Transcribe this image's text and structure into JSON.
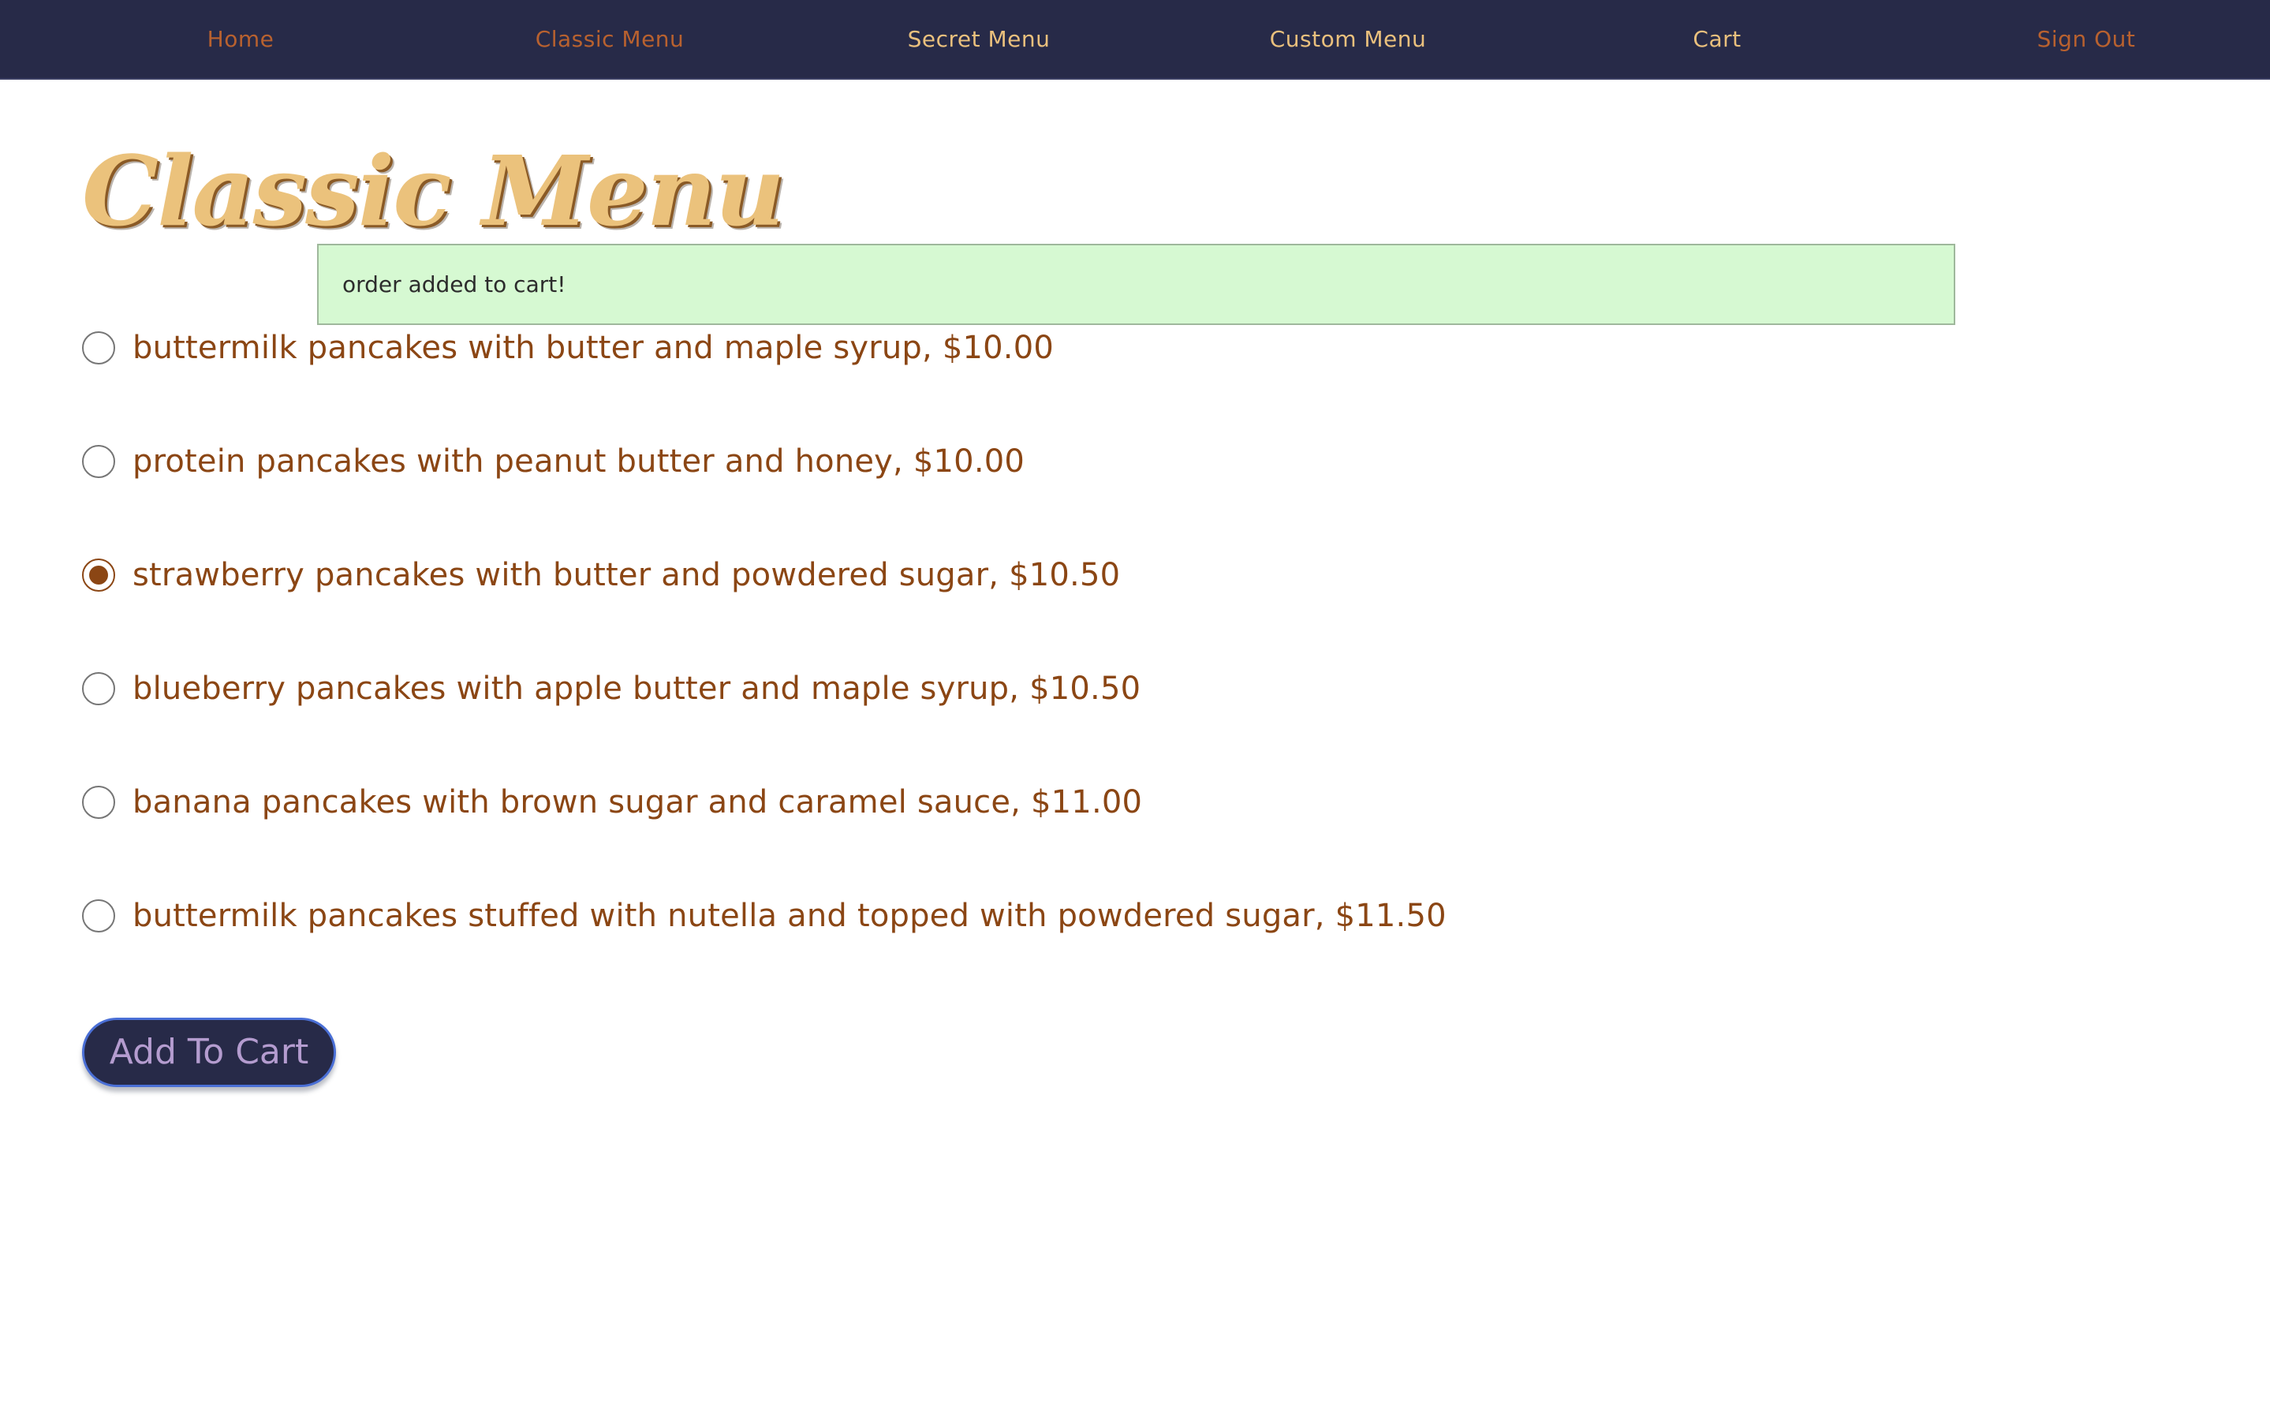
{
  "nav": {
    "items": [
      {
        "label": "Home"
      },
      {
        "label": "Classic Menu"
      },
      {
        "label": "Secret Menu"
      },
      {
        "label": "Custom Menu"
      },
      {
        "label": "Cart"
      },
      {
        "label": "Sign Out"
      }
    ]
  },
  "page": {
    "title": "Classic Menu"
  },
  "flash": {
    "message": "order added to cart!"
  },
  "menu": {
    "selected_index": 2,
    "options": [
      {
        "label": "buttermilk pancakes with butter and maple syrup, $10.00",
        "checked": false
      },
      {
        "label": "protein pancakes with peanut butter and honey, $10.00",
        "checked": false
      },
      {
        "label": "strawberry pancakes with butter and powdered sugar, $10.50",
        "checked": true
      },
      {
        "label": "blueberry pancakes with apple butter and maple syrup, $10.50",
        "checked": false
      },
      {
        "label": "banana pancakes with brown sugar and caramel sauce, $11.00",
        "checked": false
      },
      {
        "label": "buttermilk pancakes stuffed with nutella and topped with powdered sugar, $11.50",
        "checked": false
      }
    ]
  },
  "actions": {
    "add_to_cart_label": "Add To Cart"
  },
  "colors": {
    "navbar_bg": "#272a48",
    "nav_link": "#b8612f",
    "nav_link_alt": "#eac07d",
    "title": "#ebc27c",
    "option_text": "#8b4614",
    "flash_bg": "#d6f9d2",
    "button_text": "#b49ccf"
  }
}
